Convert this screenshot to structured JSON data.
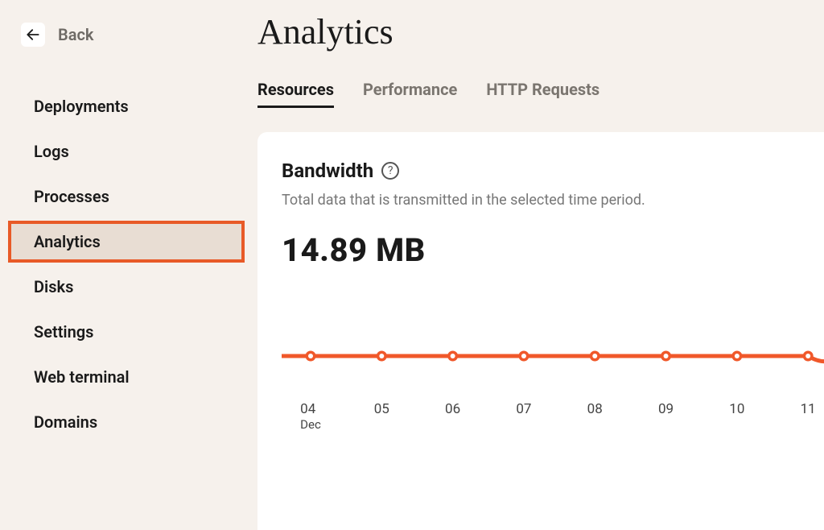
{
  "header": {
    "back_label": "Back",
    "page_title": "Analytics"
  },
  "sidebar": {
    "items": [
      {
        "label": "Deployments",
        "active": false
      },
      {
        "label": "Logs",
        "active": false
      },
      {
        "label": "Processes",
        "active": false
      },
      {
        "label": "Analytics",
        "active": true
      },
      {
        "label": "Disks",
        "active": false
      },
      {
        "label": "Settings",
        "active": false
      },
      {
        "label": "Web terminal",
        "active": false
      },
      {
        "label": "Domains",
        "active": false
      }
    ]
  },
  "tabs": [
    {
      "label": "Resources",
      "active": true
    },
    {
      "label": "Performance",
      "active": false
    },
    {
      "label": "HTTP Requests",
      "active": false
    }
  ],
  "card": {
    "title": "Bandwidth",
    "help_icon": "?",
    "description": "Total data that is transmitted in the selected time period.",
    "metric": "14.89 MB"
  },
  "chart_data": {
    "type": "line",
    "title": "Bandwidth",
    "xlabel": "Dec",
    "ylabel": "",
    "categories": [
      "04",
      "05",
      "06",
      "07",
      "08",
      "09",
      "10",
      "11"
    ],
    "month_label": "Dec",
    "values": [
      0.1,
      0.1,
      0.1,
      0.1,
      0.1,
      0.1,
      0.1,
      0.1
    ],
    "ylim": [
      0,
      15
    ],
    "series": [
      {
        "name": "Bandwidth",
        "color": "#f0582a",
        "values": [
          0.1,
          0.1,
          0.1,
          0.1,
          0.1,
          0.1,
          0.1,
          0.1
        ]
      }
    ]
  },
  "colors": {
    "accent": "#f0582a"
  }
}
